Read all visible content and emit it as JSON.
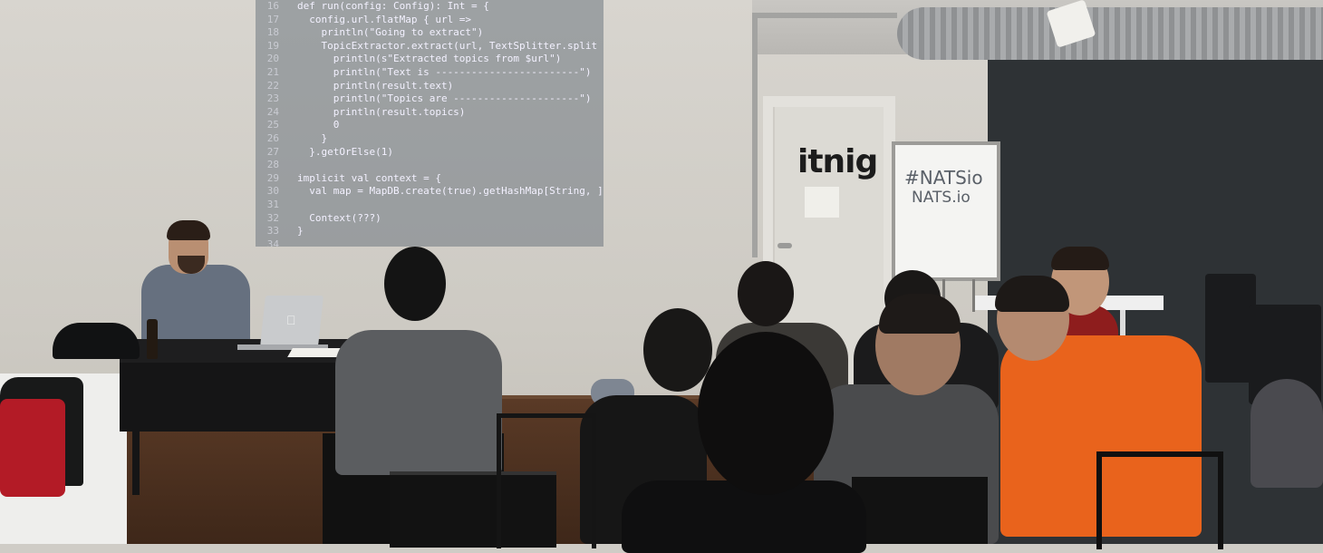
{
  "scene": {
    "description_type": "photo",
    "accent_colors": {
      "wall": "#d8d5cf",
      "dark_wall": "#2e3235",
      "floor": "#4a2f1f",
      "orange_shirt": "#e9631c"
    }
  },
  "slide": {
    "lines": [
      {
        "n": "16",
        "code": "def run(config: Config): Int = {"
      },
      {
        "n": "17",
        "code": "  config.url.flatMap { url =>"
      },
      {
        "n": "18",
        "code": "    println(\"Going to extract\")"
      },
      {
        "n": "19",
        "code": "    TopicExtractor.extract(url, TextSplitter.split"
      },
      {
        "n": "20",
        "code": "      println(s\"Extracted topics from $url\")"
      },
      {
        "n": "21",
        "code": "      println(\"Text is ------------------------\")"
      },
      {
        "n": "22",
        "code": "      println(result.text)"
      },
      {
        "n": "23",
        "code": "      println(\"Topics are ---------------------\")"
      },
      {
        "n": "24",
        "code": "      println(result.topics)"
      },
      {
        "n": "25",
        "code": "      0"
      },
      {
        "n": "26",
        "code": "    }"
      },
      {
        "n": "27",
        "code": "  }.getOrElse(1)"
      },
      {
        "n": "28",
        "code": ""
      },
      {
        "n": "29",
        "code": "implicit val context = {"
      },
      {
        "n": "30",
        "code": "  val map = MapDB.create(true).getHashMap[String, ]"
      },
      {
        "n": "31",
        "code": ""
      },
      {
        "n": "32",
        "code": "  Context(???)"
      },
      {
        "n": "33",
        "code": "}"
      },
      {
        "n": "34",
        "code": ""
      }
    ]
  },
  "door": {
    "logo": "itnig"
  },
  "whiteboard": {
    "line1": "#NATSio",
    "line2": "NATS.io"
  }
}
